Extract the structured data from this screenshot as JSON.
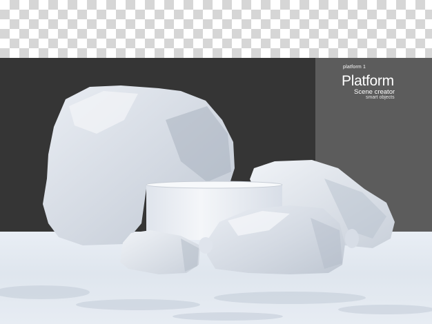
{
  "caption": {
    "label": "platform 1",
    "title": "Platform",
    "subtitle": "Scene creator",
    "tagline": "smart objects"
  },
  "colors": {
    "wall_dark": "#353535",
    "wall_grey": "#5c5c5c",
    "floor": "#e6ebf2",
    "rock": "#dfe4ec",
    "podium": "#eef1f6"
  }
}
